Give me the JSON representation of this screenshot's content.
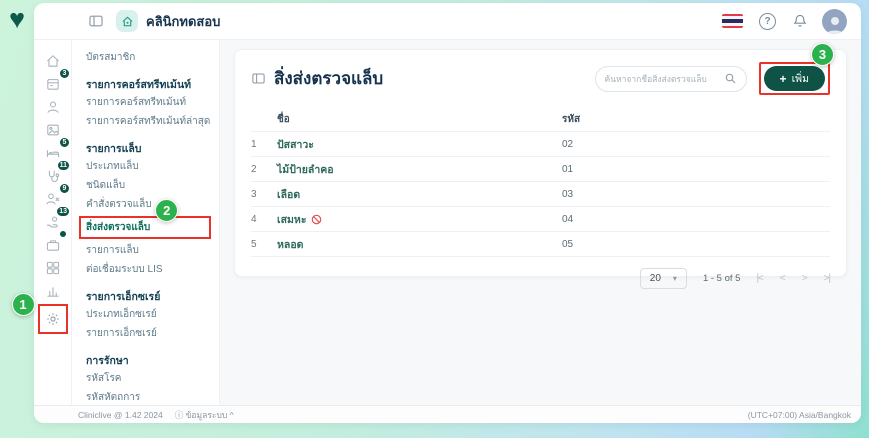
{
  "topbar": {
    "clinic_name": "คลินิกทดสอบ",
    "help_glyph": "?"
  },
  "rail": {
    "badges": {
      "wallet": "3",
      "bed": "5",
      "doctor": "11",
      "checkout": "9",
      "payment": "13"
    }
  },
  "sidebar": {
    "item_member_card": "บัตรสมาชิก",
    "header_course": "รายการคอร์สทรีทเม้นท์",
    "item_course_list": "รายการคอร์สทรีทเม้นท์",
    "item_course_latest": "รายการคอร์สทรีทเม้นท์ล่าสุด",
    "header_lab": "รายการแล็บ",
    "item_lab_type": "ประเภทแล็บ",
    "item_lab_kind": "ชนิดแล็บ",
    "item_lab_order": "คำสั่งตรวจแล็บ",
    "item_lab_specimen": "สิ่งส่งตรวจแล็บ",
    "item_lab_list": "รายการแล็บ",
    "item_lis": "ต่อเชื่อมระบบ LIS",
    "header_xray": "รายการเอ็กซเรย์",
    "item_xray_type": "ประเภทเอ็กซเรย์",
    "item_xray_list": "รายการเอ็กซเรย์",
    "header_treatment": "การรักษา",
    "item_disease_code": "รหัสโรค",
    "item_procedure_code": "รหัสหัตถการ"
  },
  "content": {
    "title": "สิ่งส่งตรวจแล็บ",
    "search_placeholder": "ค้นหาจากชื่อสิ่งส่งตรวจแล็บ",
    "add_plus": "+",
    "add_label": "เพิ่ม",
    "table": {
      "col_name": "ชื่อ",
      "col_code": "รหัส",
      "rows": [
        {
          "no": "1",
          "name": "ปัสสาวะ",
          "code": "02"
        },
        {
          "no": "2",
          "name": "ไม้ป้ายลำคอ",
          "code": "01"
        },
        {
          "no": "3",
          "name": "เลือด",
          "code": "03"
        },
        {
          "no": "4",
          "name": "เสมหะ",
          "code": "04"
        },
        {
          "no": "5",
          "name": "หลอด",
          "code": "05"
        }
      ]
    },
    "pagination": {
      "page_size": "20",
      "caret": "▾",
      "range_text": "1 - 5 of 5",
      "first": "|<",
      "prev": "<",
      "next": ">",
      "last": ">|"
    }
  },
  "annotations": {
    "step1": "1",
    "step2": "2",
    "step3": "3"
  },
  "footer": {
    "version": "Cliniclive @ 1.42 2024",
    "info_icon": "ⓘ",
    "system_info": "ข้อมูลระบบ",
    "collapse": "^",
    "timezone": "(UTC+07:00) Asia/Bangkok"
  },
  "colors": {
    "annotation_green": "#2bb24c",
    "annotation_red": "#e8322a",
    "primary_dark_green": "#0e5345"
  }
}
